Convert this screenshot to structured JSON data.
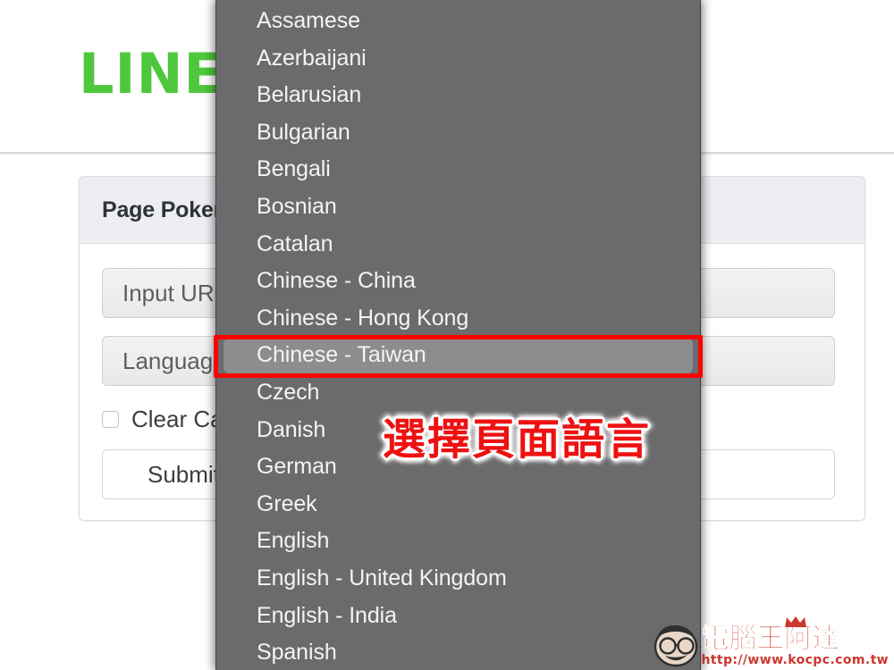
{
  "brand": {
    "logo_text": "LINE",
    "logo_color": "#4ec73c"
  },
  "card": {
    "title": "Page Poker",
    "url_field": {
      "value": "",
      "placeholder": "Input URL"
    },
    "language_select": {
      "label": "Language",
      "selected": "Chinese - Taiwan"
    },
    "clear_cache_checkbox": {
      "label": "Clear Cache",
      "checked": false
    },
    "submit_label": "Submit"
  },
  "dropdown": {
    "selected_index": 9,
    "background": "#6b6b6d",
    "highlight": "#8d8d8f",
    "items": [
      {
        "label": "Assamese"
      },
      {
        "label": "Azerbaijani"
      },
      {
        "label": "Belarusian"
      },
      {
        "label": "Bulgarian"
      },
      {
        "label": "Bengali"
      },
      {
        "label": "Bosnian"
      },
      {
        "label": "Catalan"
      },
      {
        "label": "Chinese - China"
      },
      {
        "label": "Chinese - Hong Kong"
      },
      {
        "label": "Chinese - Taiwan"
      },
      {
        "label": "Czech"
      },
      {
        "label": "Danish"
      },
      {
        "label": "German"
      },
      {
        "label": "Greek"
      },
      {
        "label": "English"
      },
      {
        "label": "English - United Kingdom"
      },
      {
        "label": "English - India"
      },
      {
        "label": "Spanish"
      }
    ]
  },
  "annotation": {
    "text": "選擇頁面語言",
    "color": "#ee1111",
    "box_color": "#ff0000"
  },
  "watermark": {
    "title": "電腦王阿達",
    "url": "http://www.kocpc.com.tw",
    "color": "#c8281e"
  }
}
